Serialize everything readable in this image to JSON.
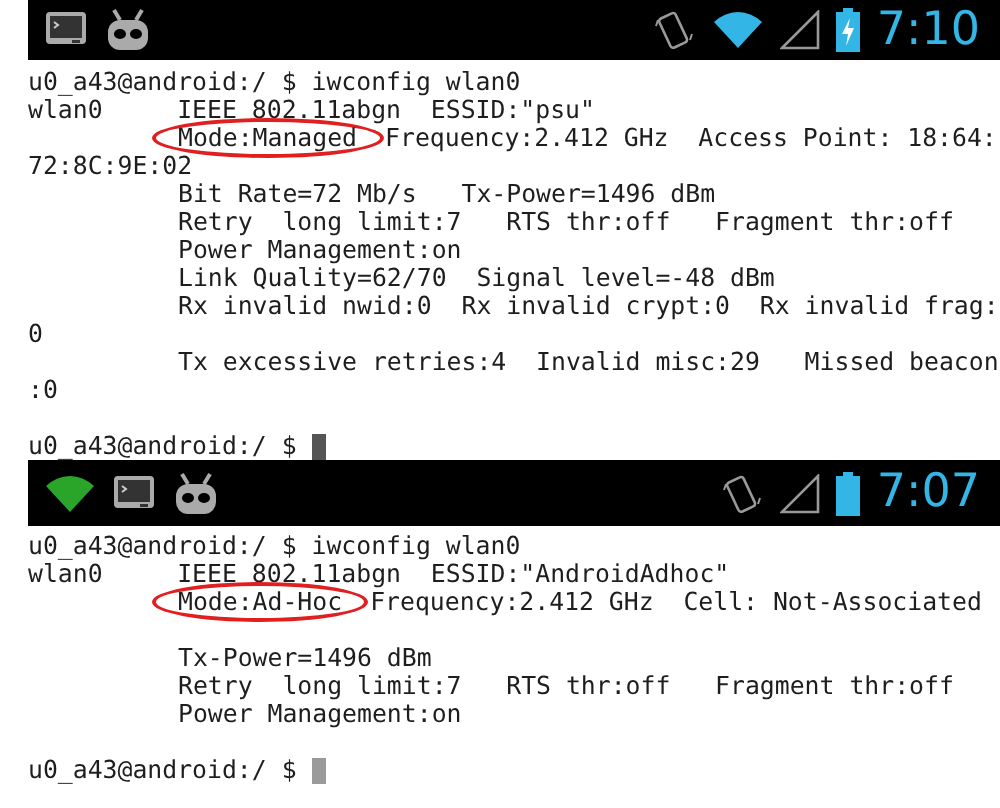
{
  "screens": [
    {
      "status_bar": {
        "left_icons": [
          {
            "kind": "terminal"
          },
          {
            "kind": "robot"
          }
        ],
        "right_icons": [
          {
            "kind": "vibrate"
          },
          {
            "kind": "wifi",
            "color": "#33b5e5"
          },
          {
            "kind": "signal"
          },
          {
            "kind": "battery",
            "charging": true
          }
        ],
        "time": "7:10"
      },
      "lines": [
        {
          "kind": "text",
          "indented": false,
          "text": "u0_a43@android:/ $ iwconfig wlan0"
        },
        {
          "kind": "text",
          "indented": false,
          "text": "wlan0     IEEE 802.11abgn  ESSID:\"psu\""
        },
        {
          "kind": "circled",
          "indented": true,
          "circled": "Mode:Managed",
          "text": "Frequency:2.412 GHz  Access Point: 18:64:"
        },
        {
          "kind": "text",
          "indented": false,
          "text": "72:8C:9E:02"
        },
        {
          "kind": "text",
          "indented": true,
          "text": "Bit Rate=72 Mb/s   Tx-Power=1496 dBm"
        },
        {
          "kind": "text",
          "indented": true,
          "text": "Retry  long limit:7   RTS thr:off   Fragment thr:off"
        },
        {
          "kind": "text",
          "indented": true,
          "text": "Power Management:on"
        },
        {
          "kind": "text",
          "indented": true,
          "text": "Link Quality=62/70  Signal level=-48 dBm"
        },
        {
          "kind": "text",
          "indented": true,
          "text": "Rx invalid nwid:0  Rx invalid crypt:0  Rx invalid frag:"
        },
        {
          "kind": "text",
          "indented": false,
          "text": "0"
        },
        {
          "kind": "text",
          "indented": true,
          "text": "Tx excessive retries:4  Invalid misc:29   Missed beacon"
        },
        {
          "kind": "text",
          "indented": false,
          "text": ":0"
        },
        {
          "kind": "blank"
        },
        {
          "kind": "prompt",
          "text": "u0_a43@android:/ $",
          "cursor": true,
          "dimmed": false
        }
      ]
    },
    {
      "status_bar": {
        "left_icons": [
          {
            "kind": "wifi",
            "color": "#2aa52a"
          },
          {
            "kind": "terminal"
          },
          {
            "kind": "robot"
          }
        ],
        "right_icons": [
          {
            "kind": "vibrate"
          },
          {
            "kind": "signal"
          },
          {
            "kind": "battery",
            "charging": false
          }
        ],
        "time": "7:07"
      },
      "lines": [
        {
          "kind": "text",
          "indented": false,
          "text": "u0_a43@android:/ $ iwconfig wlan0"
        },
        {
          "kind": "text",
          "indented": false,
          "text": "wlan0     IEEE 802.11abgn  ESSID:\"AndroidAdhoc\""
        },
        {
          "kind": "circled",
          "indented": true,
          "circled": "Mode:Ad-Hoc",
          "text": "Frequency:2.412 GHz  Cell: Not-Associated"
        },
        {
          "kind": "blank"
        },
        {
          "kind": "text",
          "indented": true,
          "text": "Tx-Power=1496 dBm"
        },
        {
          "kind": "text",
          "indented": true,
          "text": "Retry  long limit:7   RTS thr:off   Fragment thr:off"
        },
        {
          "kind": "text",
          "indented": true,
          "text": "Power Management:on"
        },
        {
          "kind": "blank"
        },
        {
          "kind": "prompt",
          "text": "u0_a43@android:/ $",
          "cursor": true,
          "dimmed": true
        }
      ]
    }
  ]
}
